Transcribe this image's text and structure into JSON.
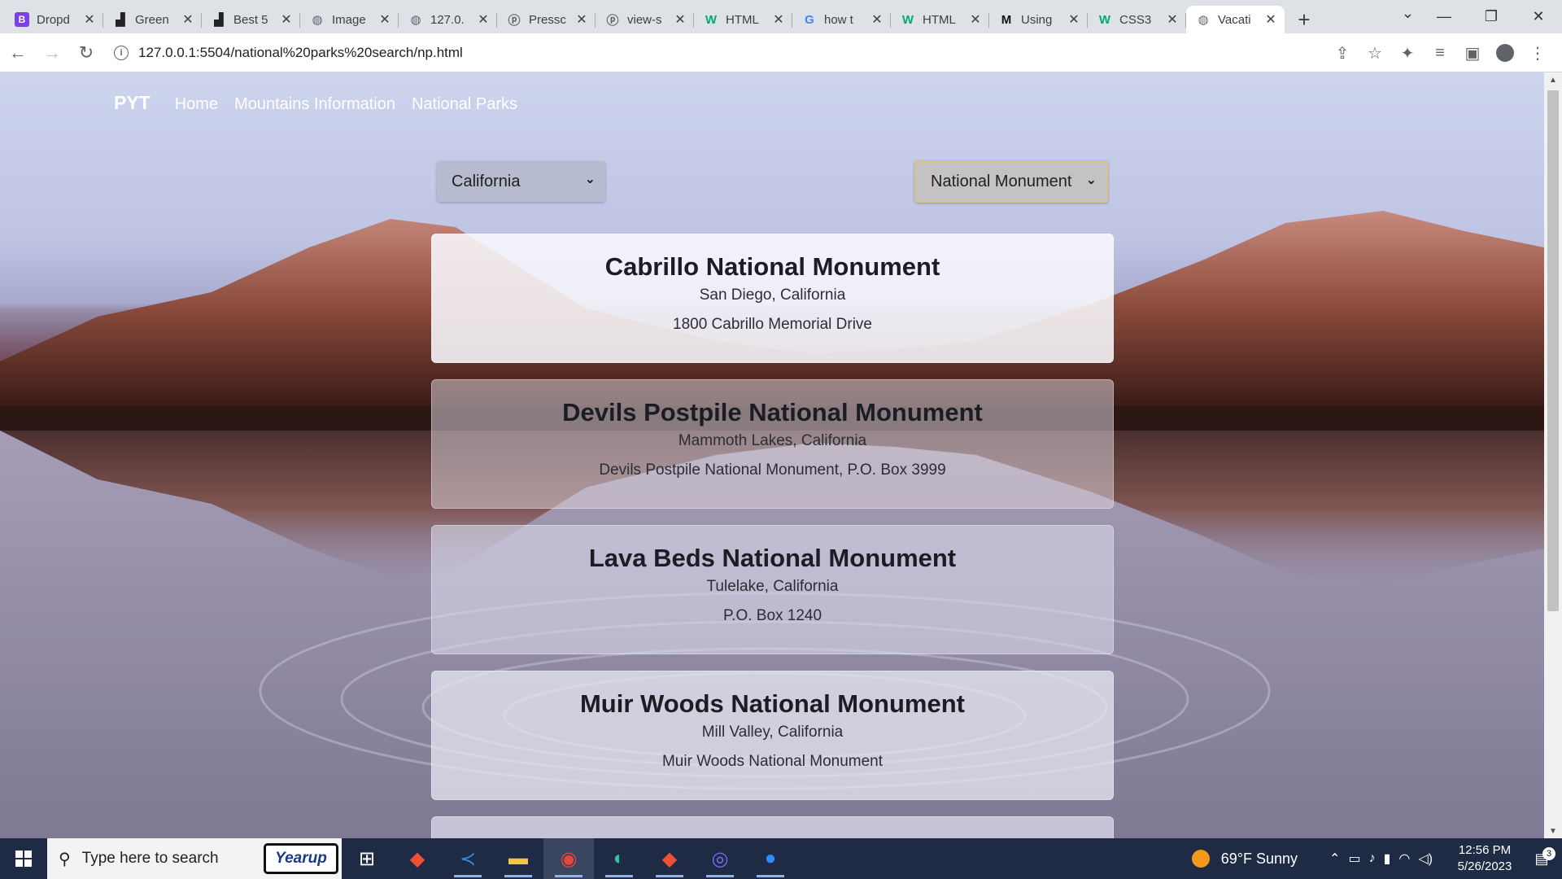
{
  "browser": {
    "tabs": [
      {
        "title": "Dropd",
        "favicon": "B",
        "favicon_color": "#7b3fe4"
      },
      {
        "title": "Green",
        "favicon": "▟",
        "favicon_color": "#222222"
      },
      {
        "title": "Best 5",
        "favicon": "▟",
        "favicon_color": "#222222"
      },
      {
        "title": "Image",
        "favicon": "◍",
        "favicon_color": "#5f6368"
      },
      {
        "title": "127.0.",
        "favicon": "◍",
        "favicon_color": "#5f6368"
      },
      {
        "title": "Pressc",
        "favicon": "ⓟ",
        "favicon_color": "#5f6368"
      },
      {
        "title": "view-s",
        "favicon": "ⓟ",
        "favicon_color": "#5f6368"
      },
      {
        "title": "HTML",
        "favicon": "W",
        "favicon_color": "#04aa6d"
      },
      {
        "title": "how t",
        "favicon": "G",
        "favicon_color": "#4285f4"
      },
      {
        "title": "HTML",
        "favicon": "W",
        "favicon_color": "#04aa6d"
      },
      {
        "title": "Using",
        "favicon": "M",
        "favicon_color": "#111111"
      },
      {
        "title": "CSS3",
        "favicon": "W",
        "favicon_color": "#04aa6d"
      },
      {
        "title": "Vacati",
        "favicon": "◍",
        "favicon_color": "#5f6368",
        "active": true
      }
    ],
    "url": "127.0.0.1:5504/national%20parks%20search/np.html"
  },
  "site": {
    "brand": "PYT",
    "nav": [
      "Home",
      "Mountains Information",
      "National Parks"
    ]
  },
  "filters": {
    "state_selected": "California",
    "type_selected": "National Monument"
  },
  "cards": [
    {
      "title": "Cabrillo National Monument",
      "city": "San Diego, California",
      "address": "1800 Cabrillo Memorial Drive"
    },
    {
      "title": "Devils Postpile National Monument",
      "city": "Mammoth Lakes, California",
      "address": "Devils Postpile National Monument, P.O. Box 3999"
    },
    {
      "title": "Lava Beds National Monument",
      "city": "Tulelake, California",
      "address": "P.O. Box 1240"
    },
    {
      "title": "Muir Woods National Monument",
      "city": "Mill Valley, California",
      "address": "Muir Woods National Monument"
    }
  ],
  "taskbar": {
    "search_placeholder": "Type here to search",
    "pinned_label": "Yearup",
    "weather": "69°F  Sunny",
    "time": "12:56 PM",
    "date": "5/26/2023",
    "notification_count": "3"
  },
  "colors": {
    "accent_select_border": "#d8c38a",
    "taskbar_bg": "#1f2a44"
  }
}
